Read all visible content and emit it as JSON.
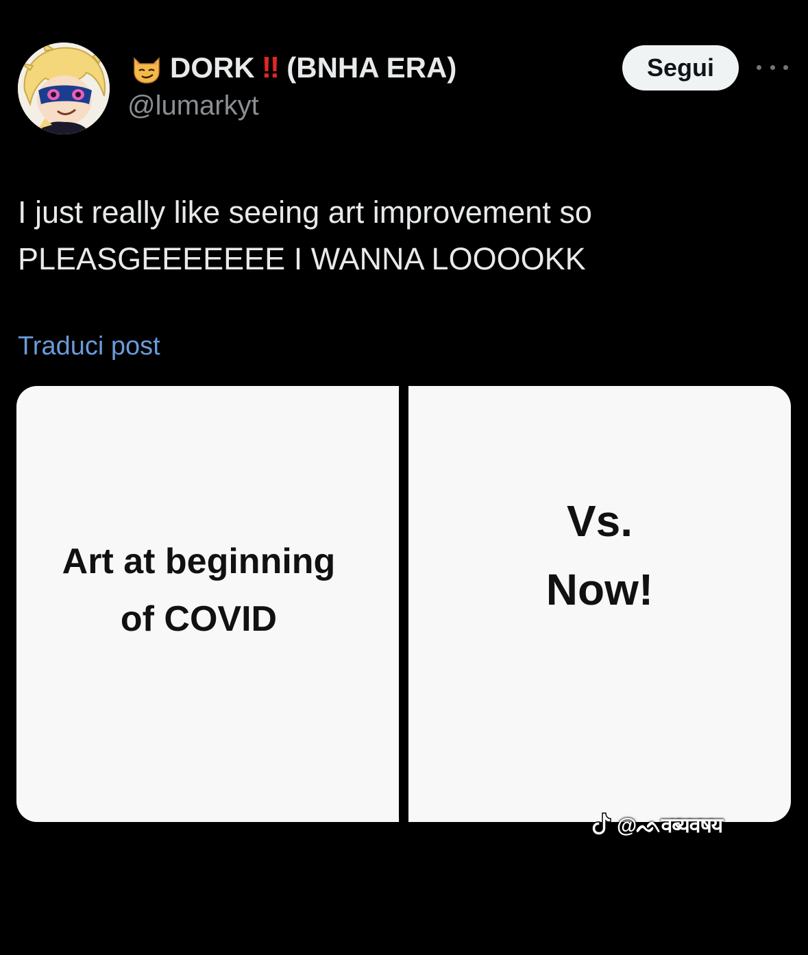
{
  "author": {
    "display_name": "DORK",
    "exclamation": "‼",
    "name_suffix": "(BNHA ERA)",
    "handle": "@lumarkyt",
    "emoji_icon": "smirking-cat-icon"
  },
  "actions": {
    "follow_label": "Segui",
    "more_icon": "more-dots-icon"
  },
  "tweet": {
    "line1": "I just really like seeing art improvement so",
    "line2": "PLEASGEEEEEEE I WANNA LOOOOKK",
    "translate_label": "Traduci post"
  },
  "media": {
    "left_caption_line1": "Art at beginning",
    "left_caption_line2": "of COVID",
    "right_caption_line1": "Vs.",
    "right_caption_line2": "Now!"
  },
  "watermark": {
    "icon": "tiktok-icon",
    "text": "@ᨒवब्यवषय"
  },
  "colors": {
    "background": "#000000",
    "text_primary": "#e7e9ea",
    "text_secondary": "#8b8f94",
    "link": "#6a9bd8",
    "follow_bg": "#eff3f4",
    "exclamation_red": "#e0281f",
    "panel_bg": "#f8f8f8"
  }
}
